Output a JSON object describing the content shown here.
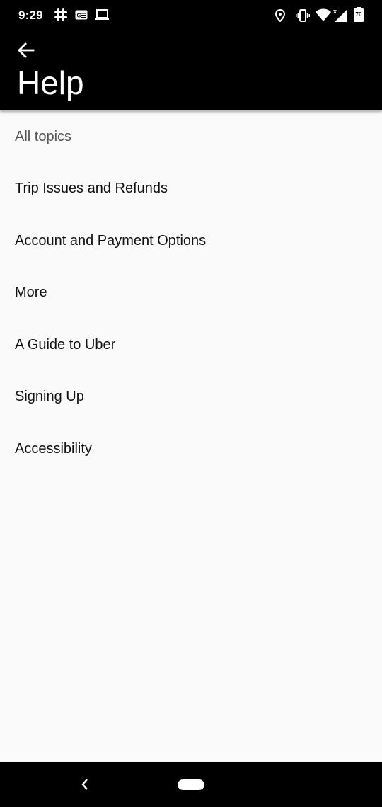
{
  "status_bar": {
    "time": "9:29",
    "battery_level": "70",
    "icons": [
      "slack-icon",
      "news-icon",
      "cast-icon",
      "location-icon",
      "vibrate-icon",
      "wifi-icon",
      "signal-icon",
      "battery-icon"
    ]
  },
  "app_bar": {
    "title": "Help",
    "back_icon": "arrow-back-icon"
  },
  "topics": {
    "header": "All topics",
    "items": [
      "Trip Issues and Refunds",
      "Account and Payment Options",
      "More",
      "A Guide to Uber",
      "Signing Up",
      "Accessibility"
    ]
  },
  "colors": {
    "app_bar_bg": "#000000",
    "page_bg": "#fafafa",
    "text": "#111111"
  }
}
